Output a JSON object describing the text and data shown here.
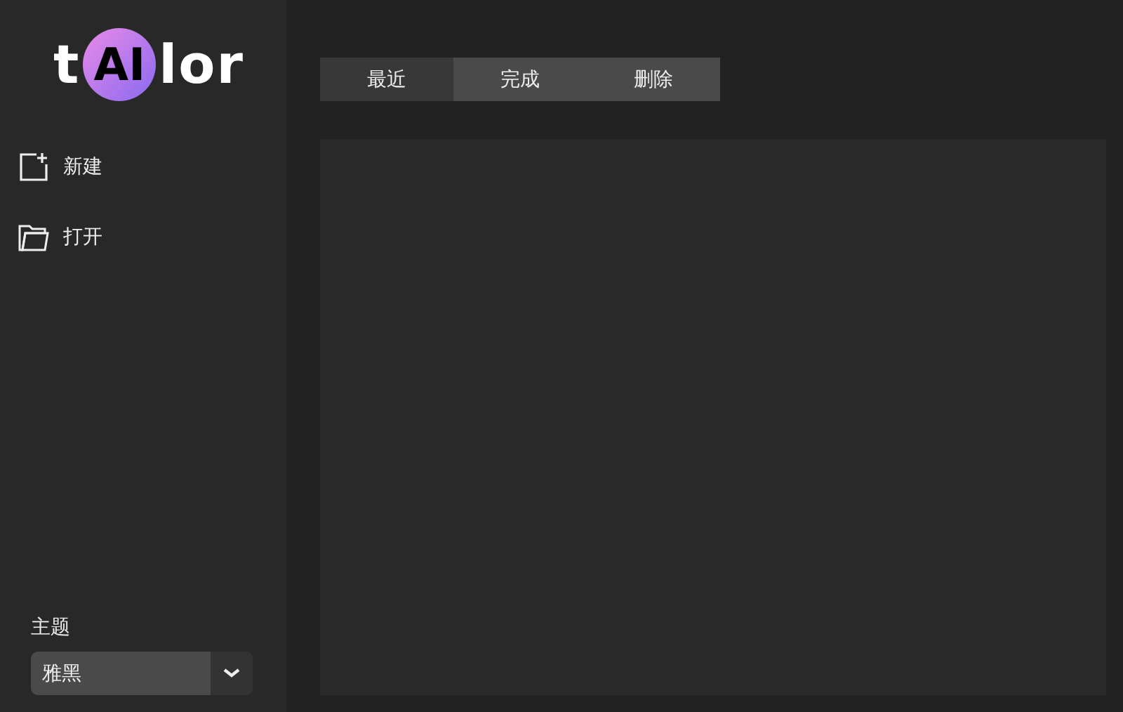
{
  "logo": {
    "parts": [
      {
        "text": "t",
        "kind": "plain"
      },
      {
        "text": "AI",
        "kind": "badge"
      },
      {
        "text": "lor",
        "kind": "plain"
      }
    ]
  },
  "sidebar": {
    "items": [
      {
        "label": "新建",
        "kind": "new"
      },
      {
        "label": "打开",
        "kind": "open"
      }
    ]
  },
  "theme": {
    "label": "主题",
    "value": "雅黑"
  },
  "tabs": [
    {
      "label": "最近",
      "selected": true
    },
    {
      "label": "完成",
      "selected": false
    },
    {
      "label": "删除",
      "selected": false
    }
  ]
}
